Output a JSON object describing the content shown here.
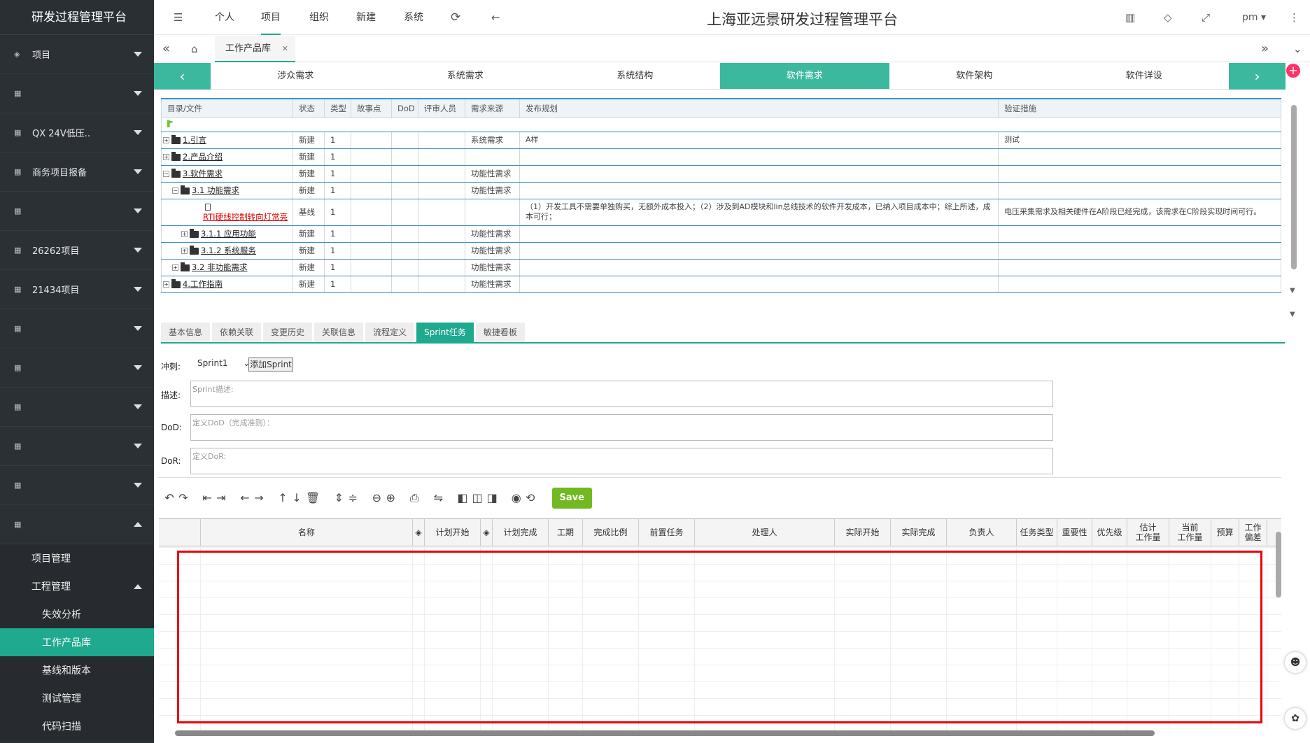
{
  "brand": "研发过程管理平台",
  "title": "上海亚远景研发过程管理平台",
  "topnav": [
    "个人",
    "项目",
    "组织",
    "新建",
    "系统"
  ],
  "user": "pm",
  "sidebar": {
    "items": [
      {
        "label": "项目",
        "caret": "down"
      },
      {
        "label": "",
        "blur": 60,
        "caret": "down"
      },
      {
        "label": "QX 24V低压..",
        "caret": "down"
      },
      {
        "label": "商务项目报备",
        "caret": "down"
      },
      {
        "label": "",
        "blur": 85,
        "caret": "down"
      },
      {
        "label": "26262项目",
        "caret": "down"
      },
      {
        "label": "21434项目",
        "caret": "down"
      },
      {
        "label": "",
        "blur": 85,
        "caret": "down"
      },
      {
        "label": "",
        "blur": 160,
        "caret": "down"
      },
      {
        "label": "",
        "blur": 60,
        "caret": "down"
      },
      {
        "label": "",
        "blur": 75,
        "caret": "down"
      },
      {
        "label": "",
        "blur": 60,
        "caret": "down"
      },
      {
        "label": "",
        "blur": 72,
        "caret": "up"
      }
    ],
    "sub": [
      {
        "label": "项目管理",
        "indent": 45
      },
      {
        "label": "工程管理",
        "indent": 45,
        "caret": true
      },
      {
        "label": "失效分析",
        "indent": 60
      },
      {
        "label": "工作产品库",
        "indent": 60,
        "active": true
      },
      {
        "label": "基线和版本",
        "indent": 60
      },
      {
        "label": "测试管理",
        "indent": 60
      },
      {
        "label": "代码扫描",
        "indent": 60
      }
    ]
  },
  "open_tab": "工作产品库",
  "stages": [
    "涉众需求",
    "系统需求",
    "系统结构",
    "软件需求",
    "软件架构",
    "软件详设"
  ],
  "active_stage": "软件需求",
  "tree": {
    "headers": [
      "目录/文件",
      "状态",
      "类型",
      "故事点",
      "DoD",
      "评审人员",
      "需求来源",
      "发布规划",
      "验证措施"
    ],
    "rows": [
      {
        "name": "1.引言",
        "lvl": 0,
        "pm": "+",
        "status": "新建",
        "type": "1",
        "src": "系统需求",
        "plan": "A样",
        "verify": "测试"
      },
      {
        "name": "2.产品介绍",
        "lvl": 0,
        "pm": "+",
        "status": "新建",
        "type": "1",
        "src": "",
        "plan": "",
        "verify": ""
      },
      {
        "name": "3.软件需求",
        "lvl": 0,
        "pm": "−",
        "status": "新建",
        "type": "1",
        "src": "功能性需求",
        "plan": "",
        "verify": ""
      },
      {
        "name": "3.1 功能需求",
        "lvl": 1,
        "pm": "−",
        "status": "新建",
        "type": "1",
        "src": "功能性需求",
        "plan": "",
        "verify": ""
      },
      {
        "name": "RTI硬线控制转向灯常亮",
        "lvl": 2,
        "doc": true,
        "red": true,
        "status": "基线",
        "type": "1",
        "src": "",
        "plan": "（1）开发工具不需要单独购买，无额外成本投入；（2）涉及到AD模块和lin总线技术的软件开发成本，已纳入项目成本中；综上所述，成本可行；",
        "verify": "电压采集需求及相关硬件在A阶段已经完成，该需求在C阶段实现时间可行。"
      },
      {
        "name": "3.1.1 应用功能",
        "lvl": 2,
        "pm": "+",
        "status": "新建",
        "type": "1",
        "src": "功能性需求",
        "plan": "",
        "verify": ""
      },
      {
        "name": "3.1.2 系统服务",
        "lvl": 2,
        "pm": "+",
        "status": "新建",
        "type": "1",
        "src": "功能性需求",
        "plan": "",
        "verify": ""
      },
      {
        "name": "3.2 非功能需求",
        "lvl": 1,
        "pm": "+",
        "status": "新建",
        "type": "1",
        "src": "功能性需求",
        "plan": "",
        "verify": ""
      },
      {
        "name": "4.工作指南",
        "lvl": 0,
        "pm": "+",
        "status": "新建",
        "type": "1",
        "src": "功能性需求",
        "plan": "",
        "verify": ""
      }
    ]
  },
  "subtabs": [
    "基本信息",
    "依赖关联",
    "变更历史",
    "关联信息",
    "流程定义",
    "Sprint任务",
    "敏捷看板"
  ],
  "active_subtab": "Sprint任务",
  "sprint": {
    "label": "冲刺:",
    "selected": "Sprint1",
    "add_button": "添加Sprint",
    "desc_label": "描述:",
    "desc_placeholder": "Sprint描述:",
    "dod_label": "DoD:",
    "dod_placeholder": "定义DoD（完成准则）：",
    "dor_label": "DoR:",
    "dor_placeholder": "定义DoR:"
  },
  "save_label": "Save",
  "grid_headers": [
    {
      "t": "",
      "w": 60
    },
    {
      "t": "名称",
      "w": 303
    },
    {
      "t": "◈",
      "w": 17
    },
    {
      "t": "计划开始",
      "w": 80
    },
    {
      "t": "◈",
      "w": 17
    },
    {
      "t": "计划完成",
      "w": 80
    },
    {
      "t": "工期",
      "w": 49
    },
    {
      "t": "完成比例",
      "w": 80
    },
    {
      "t": "前置任务",
      "w": 80
    },
    {
      "t": "处理人",
      "w": 200
    },
    {
      "t": "实际开始",
      "w": 80
    },
    {
      "t": "实际完成",
      "w": 80
    },
    {
      "t": "负责人",
      "w": 100
    },
    {
      "t": "任务类型",
      "w": 58
    },
    {
      "t": "重要性",
      "w": 50
    },
    {
      "t": "优先级",
      "w": 50
    },
    {
      "t": "估计\n工作量",
      "w": 60
    },
    {
      "t": "当前\n工作量",
      "w": 60
    },
    {
      "t": "预算",
      "w": 40
    },
    {
      "t": "工作\n偏差",
      "w": 40
    }
  ]
}
